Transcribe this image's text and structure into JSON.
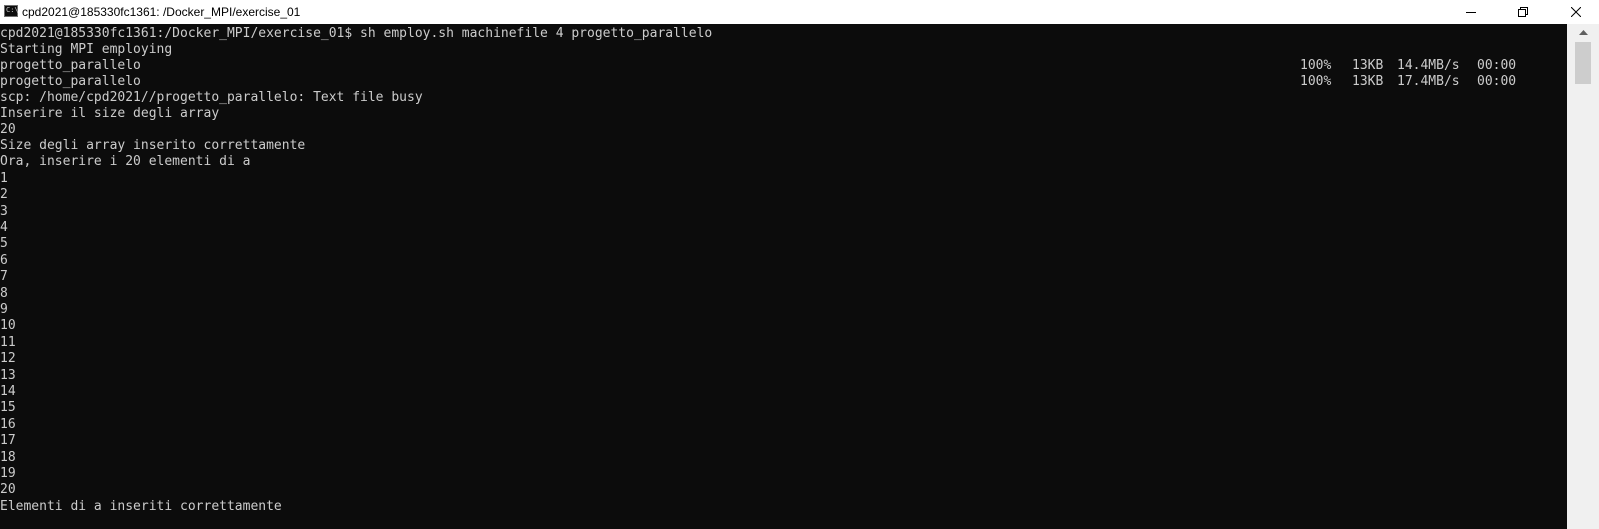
{
  "window": {
    "title": "cpd2021@185330fc1361: /Docker_MPI/exercise_01",
    "icon": "console-icon",
    "icon_glyph": "C:\\",
    "buttons": [
      "minimize",
      "maximize",
      "close"
    ]
  },
  "terminal": {
    "lines": [
      "cpd2021@185330fc1361:/Docker_MPI/exercise_01$ sh employ.sh machinefile 4 progetto_parallelo",
      "Starting MPI employing",
      "progetto_parallelo",
      "progetto_parallelo",
      "scp: /home/cpd2021//progetto_parallelo: Text file busy",
      "Inserire il size degli array",
      "20",
      "Size degli array inserito correttamente",
      "Ora, inserire i 20 elementi di a",
      "1",
      "2",
      "3",
      "4",
      "5",
      "6",
      "7",
      "8",
      "9",
      "10",
      "11",
      "12",
      "13",
      "14",
      "15",
      "16",
      "17",
      "18",
      "19",
      "20",
      "Elementi di a inseriti correttamente"
    ],
    "transfers": [
      {
        "percent": "100%",
        "size": "13KB",
        "rate": "14.4MB/s",
        "eta": "00:00"
      },
      {
        "percent": "100%",
        "size": "13KB",
        "rate": "17.4MB/s",
        "eta": "00:00"
      }
    ]
  },
  "colors": {
    "background": "#0c0c0c",
    "text": "#cccccc",
    "titlebar": "#ffffff"
  }
}
